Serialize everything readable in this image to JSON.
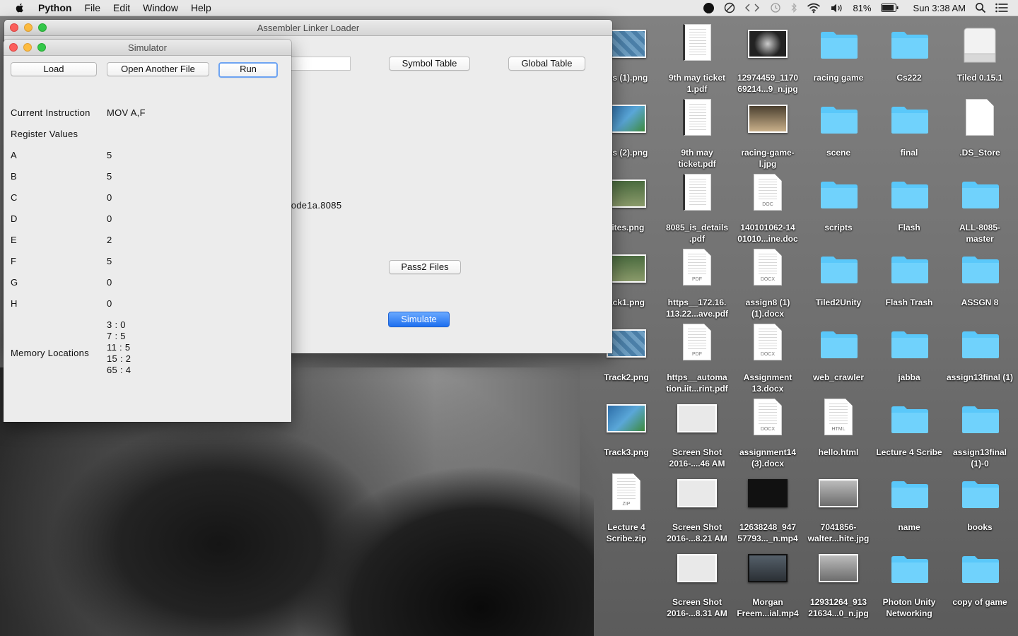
{
  "menubar": {
    "app_name": "Python",
    "menus": [
      "File",
      "Edit",
      "Window",
      "Help"
    ],
    "battery": "81%",
    "clock": "Sun 3:38 AM"
  },
  "main_window": {
    "title": "Assembler Linker Loader",
    "symbol_table_label": "Symbol Table",
    "global_table_label": "Global Table",
    "file_text": "Code1a.8085",
    "pass2_label": "Pass2 Files",
    "simulate_label": "Simulate"
  },
  "simulator": {
    "title": "Simulator",
    "load_label": "Load",
    "open_label": "Open Another File",
    "run_label": "Run",
    "current_instruction_label": "Current Instruction",
    "current_instruction_value": "MOV A,F",
    "register_values_label": "Register Values",
    "registers": [
      {
        "name": "A",
        "value": "5"
      },
      {
        "name": "B",
        "value": "5"
      },
      {
        "name": "C",
        "value": "0"
      },
      {
        "name": "D",
        "value": "0"
      },
      {
        "name": "E",
        "value": "2"
      },
      {
        "name": "F",
        "value": "5"
      },
      {
        "name": "G",
        "value": "0"
      },
      {
        "name": "H",
        "value": "0"
      }
    ],
    "memory_locations_label": "Memory Locations",
    "memory": [
      "3 : 0",
      "7 : 5",
      "11 : 5",
      "15 : 2",
      "65 : 4"
    ]
  },
  "desktop": {
    "columns": [
      [
        "tes (1).png",
        "tes (2).png",
        "rites.png",
        "ack1.png",
        "Track2.png",
        "Track3.png",
        "Lecture 4 Scribe.zip",
        ""
      ],
      [
        "9th may ticket 1.pdf",
        "9th may ticket.pdf",
        "8085_is_details .pdf",
        "https__172.16. 113.22...ave.pdf",
        "https__automa tion.iit...rint.pdf",
        "Screen Shot 2016-....46 AM",
        "Screen Shot 2016-...8.21 AM",
        "Screen Shot 2016-...8.31 AM"
      ],
      [
        "12974459_1170 69214...9_n.jpg",
        "racing-game- l.jpg",
        "140101062-14 01010...ine.doc",
        "assign8 (1) (1).docx",
        "Assignment 13.docx",
        "assignment14 (3).docx",
        "12638248_947 57793..._n.mp4",
        "Morgan Freem...ial.mp4"
      ],
      [
        "racing game",
        "scene",
        "scripts",
        "Tiled2Unity",
        "web_crawler",
        "hello.html",
        "7041856- walter...hite.jpg",
        "12931264_913 21634...0_n.jpg"
      ],
      [
        "Cs222",
        "final",
        "Flash",
        "Flash Trash",
        "jabba",
        "Lecture 4 Scribe",
        "name",
        "Photon Unity Networking"
      ],
      [
        "Tiled 0.15.1",
        ".DS_Store",
        "ALL-8085- master",
        "ASSGN 8",
        "assign13final (1)",
        "assign13final (1)-0",
        "books",
        "copy of game"
      ]
    ],
    "kinds": [
      [
        "picture-track",
        "picture-map",
        "picture-green",
        "picture-green",
        "picture-track",
        "picture-map",
        "zip",
        ""
      ],
      [
        "scan-doc",
        "scan-doc",
        "scan-doc",
        "pdf",
        "pdf",
        "screenshot",
        "screenshot",
        "screenshot"
      ],
      [
        "photo-dark",
        "photo-car",
        "doc",
        "docx",
        "docx",
        "docx",
        "video-dark",
        "video-car"
      ],
      [
        "folder",
        "folder",
        "folder",
        "folder",
        "folder",
        "html",
        "photo-screen",
        "photo-screen"
      ],
      [
        "folder",
        "folder",
        "folder",
        "folder",
        "folder",
        "folder",
        "folder",
        "folder"
      ],
      [
        "drive",
        "blank",
        "folder",
        "folder",
        "folder",
        "folder",
        "folder",
        "folder"
      ]
    ],
    "file_tags": {
      "pdf": "PDF",
      "doc": "DOC",
      "docx": "DOCX",
      "zip": "ZIP",
      "html": "HTML"
    }
  },
  "colors": {
    "folder": "#5ac8fa",
    "primary_button": "#1d6fef",
    "focus_ring": "#6ea4f2"
  }
}
